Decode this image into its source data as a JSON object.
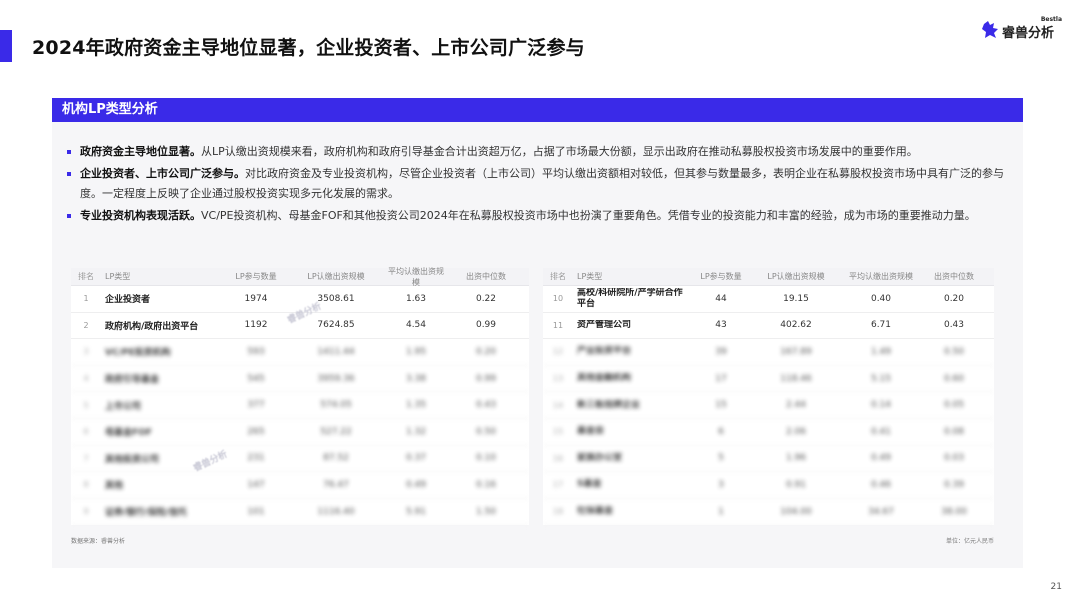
{
  "colors": {
    "accent": "#3a2ae8",
    "bullet": "#3a2ae8"
  },
  "page": {
    "title": "2024年政府资金主导地位显著，企业投资者、上市公司广泛参与",
    "page_number": "21"
  },
  "logo": {
    "small_text": "Bestla",
    "name": "睿兽分析",
    "icon": "beast-logo-icon"
  },
  "section": {
    "title": "机构LP类型分析"
  },
  "bullets": [
    {
      "bold": "政府资金主导地位显著。",
      "text": "从LP认缴出资规模来看，政府机构和政府引导基金合计出资超万亿，占据了市场最大份额，显示出政府在推动私募股权投资市场发展中的重要作用。"
    },
    {
      "bold": "企业投资者、上市公司广泛参与。",
      "text": "对比政府资金及专业投资机构，尽管企业投资者（上市公司）平均认缴出资额相对较低，但其参与数量最多，表明企业在私募股权投资市场中具有广泛的参与度。一定程度上反映了企业通过股权投资实现多元化发展的需求。"
    },
    {
      "bold": "专业投资机构表现活跃。",
      "text": "VC/PE投资机构、母基金FOF和其他投资公司2024年在私募股权投资市场中也扮演了重要角色。凭借专业的投资能力和丰富的经验，成为市场的重要推动力量。"
    }
  ],
  "table_headers": {
    "rank": "排名",
    "type": "LP类型",
    "lp_count": "LP参与数量",
    "scale": "LP认缴出资规模",
    "avg": "平均认缴出资规模",
    "median": "出资中位数"
  },
  "left_rows": [
    {
      "rank": "1",
      "type": "企业投资者",
      "lp_count": "1974",
      "scale": "3508.61",
      "avg": "1.63",
      "median": "0.22"
    },
    {
      "rank": "2",
      "type": "政府机构/政府出资平台",
      "lp_count": "1192",
      "scale": "7624.85",
      "avg": "4.54",
      "median": "0.99"
    },
    {
      "rank": "3",
      "type": "VC/PE投资机构",
      "lp_count": "593",
      "scale": "1411.44",
      "avg": "1.95",
      "median": "0.20"
    },
    {
      "rank": "4",
      "type": "政府引导基金",
      "lp_count": "545",
      "scale": "3959.36",
      "avg": "3.38",
      "median": "0.99"
    },
    {
      "rank": "5",
      "type": "上市公司",
      "lp_count": "377",
      "scale": "574.05",
      "avg": "1.35",
      "median": "0.43"
    },
    {
      "rank": "6",
      "type": "母基金FOF",
      "lp_count": "265",
      "scale": "527.22",
      "avg": "1.32",
      "median": "0.50"
    },
    {
      "rank": "7",
      "type": "其他投资公司",
      "lp_count": "231",
      "scale": "87.52",
      "avg": "0.37",
      "median": "0.10"
    },
    {
      "rank": "8",
      "type": "其他",
      "lp_count": "147",
      "scale": "76.47",
      "avg": "0.49",
      "median": "0.16"
    },
    {
      "rank": "9",
      "type": "证券/银行/保险/信托",
      "lp_count": "101",
      "scale": "1116.40",
      "avg": "5.91",
      "median": "1.50"
    }
  ],
  "right_rows": [
    {
      "rank": "10",
      "type": "高校/科研院所/产学研合作平台",
      "lp_count": "44",
      "scale": "19.15",
      "avg": "0.40",
      "median": "0.20"
    },
    {
      "rank": "11",
      "type": "资产管理公司",
      "lp_count": "43",
      "scale": "402.62",
      "avg": "6.71",
      "median": "0.43"
    },
    {
      "rank": "12",
      "type": "产业投资平台",
      "lp_count": "39",
      "scale": "167.89",
      "avg": "1.49",
      "median": "0.50"
    },
    {
      "rank": "13",
      "type": "其他金融机构",
      "lp_count": "17",
      "scale": "118.46",
      "avg": "5.15",
      "median": "0.60"
    },
    {
      "rank": "14",
      "type": "新三板挂牌企业",
      "lp_count": "15",
      "scale": "2.44",
      "avg": "0.14",
      "median": "0.05"
    },
    {
      "rank": "15",
      "type": "基金会",
      "lp_count": "6",
      "scale": "2.06",
      "avg": "0.41",
      "median": "0.08"
    },
    {
      "rank": "16",
      "type": "家族办公室",
      "lp_count": "5",
      "scale": "1.96",
      "avg": "0.49",
      "median": "0.03"
    },
    {
      "rank": "17",
      "type": "S基金",
      "lp_count": "3",
      "scale": "0.91",
      "avg": "0.46",
      "median": "0.39"
    },
    {
      "rank": "18",
      "type": "社保基金",
      "lp_count": "1",
      "scale": "104.00",
      "avg": "34.67",
      "median": "38.00"
    }
  ],
  "footer": {
    "source": "数据来源：睿兽分析",
    "unit": "单位：亿元人民币"
  },
  "watermark": "睿兽分析"
}
